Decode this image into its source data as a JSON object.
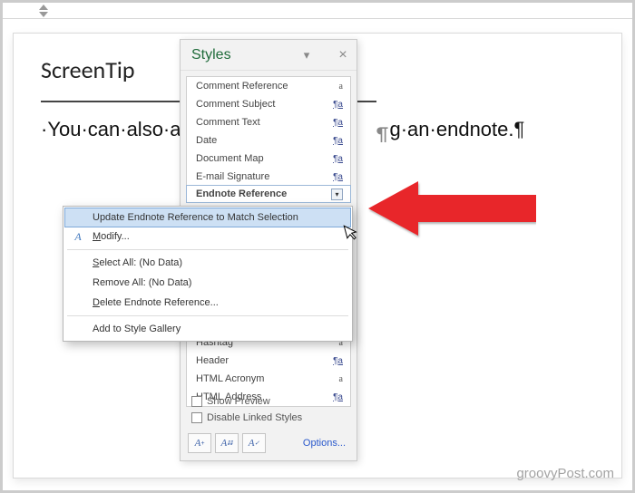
{
  "document": {
    "heading": "ScreenTip",
    "body_prefix": "·You·can·also·a",
    "body_suffix": "g·an·endnote.¶",
    "paragraph_mark": "¶"
  },
  "styles_pane": {
    "title": "Styles",
    "items_top": [
      {
        "name": "Comment Reference",
        "badge": "a",
        "badge_type": "a"
      },
      {
        "name": "Comment Subject",
        "badge": "¶a",
        "badge_type": "pa"
      },
      {
        "name": "Comment Text",
        "badge": "¶a",
        "badge_type": "pa"
      },
      {
        "name": "Date",
        "badge": "¶a",
        "badge_type": "pa"
      },
      {
        "name": "Document Map",
        "badge": "¶a",
        "badge_type": "pa"
      },
      {
        "name": "E-mail Signature",
        "badge": "¶a",
        "badge_type": "pa"
      },
      {
        "name": "Endnote Reference",
        "badge": "",
        "badge_type": "dd",
        "selected": true
      }
    ],
    "items_bottom": [
      {
        "name": "Hashtag",
        "badge": "a",
        "badge_type": "a"
      },
      {
        "name": "Header",
        "badge": "¶a",
        "badge_type": "pa"
      },
      {
        "name": "HTML Acronym",
        "badge": "a",
        "badge_type": "a"
      },
      {
        "name": "HTML Address",
        "badge": "¶a",
        "badge_type": "pa"
      }
    ],
    "show_preview": "Show Preview",
    "disable_linked": "Disable Linked Styles",
    "options": "Options..."
  },
  "context_menu": {
    "update": "Update Endnote Reference to Match Selection",
    "modify": "Modify...",
    "select_all": "Select All: (No Data)",
    "remove_all": "Remove All: (No Data)",
    "delete": "Delete Endnote Reference...",
    "add_gallery": "Add to Style Gallery"
  },
  "watermark": "groovyPost.com"
}
